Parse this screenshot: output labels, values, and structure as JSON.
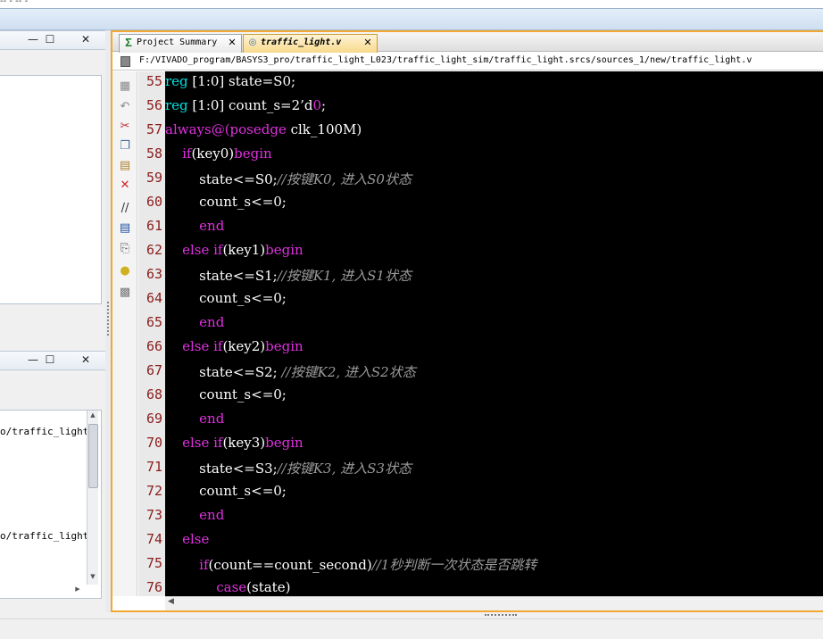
{
  "window": {
    "title_fragment": "-- - -- -"
  },
  "left_panes": [
    {
      "controls": {
        "minimize": "—",
        "maximize": "☐",
        "close": "✕"
      }
    },
    {
      "controls": {
        "minimize": "—",
        "maximize": "☐",
        "close": "✕"
      },
      "items": [
        "o/traffic_light_",
        "o/traffic_light_"
      ]
    }
  ],
  "tabs": [
    {
      "icon": "sigma-icon",
      "label": "Project Summary",
      "close": "✕",
      "active": false
    },
    {
      "icon": "verilog-file-icon",
      "label": "traffic_light.v",
      "close": "✕",
      "active": true
    }
  ],
  "file_path": "F:/VIVADO_program/BASYS3_pro/traffic_light_L023/traffic_light_sim/traffic_light.srcs/sources_1/new/traffic_light.v",
  "toolbar_icons": [
    "save-icon",
    "undo-icon",
    "cut-icon",
    "copy-icon",
    "paste-icon",
    "delete-icon",
    "comment-icon",
    "select-block-icon",
    "replace-icon",
    "hint-bulb-icon",
    "settings-icon"
  ],
  "code_lines": [
    {
      "n": "55",
      "tokens": [
        {
          "t": "reg",
          "c": "kw"
        },
        {
          "t": " [1:0] state=S0;",
          "c": ""
        }
      ]
    },
    {
      "n": "56",
      "tokens": [
        {
          "t": "reg",
          "c": "kw"
        },
        {
          "t": " [1:0] count_s=2’d",
          "c": ""
        },
        {
          "t": "0",
          "c": "mg"
        },
        {
          "t": ";",
          "c": ""
        }
      ]
    },
    {
      "n": "57",
      "tokens": [
        {
          "t": "always@(",
          "c": "mg"
        },
        {
          "t": "posedge",
          "c": "mg"
        },
        {
          "t": " clk_100M)",
          "c": ""
        }
      ]
    },
    {
      "n": "58",
      "tokens": [
        {
          "t": "    ",
          "c": ""
        },
        {
          "t": "if",
          "c": "mg"
        },
        {
          "t": "(key0)",
          "c": ""
        },
        {
          "t": "begin",
          "c": "mg"
        }
      ]
    },
    {
      "n": "59",
      "tokens": [
        {
          "t": "        state<=S0;",
          "c": ""
        },
        {
          "t": "//按键K0, 进入S0状态",
          "c": "cm"
        }
      ]
    },
    {
      "n": "60",
      "tokens": [
        {
          "t": "        count_s<=0;",
          "c": ""
        }
      ]
    },
    {
      "n": "61",
      "tokens": [
        {
          "t": "        ",
          "c": ""
        },
        {
          "t": "end",
          "c": "mg"
        }
      ]
    },
    {
      "n": "62",
      "tokens": [
        {
          "t": "    ",
          "c": ""
        },
        {
          "t": "else if",
          "c": "mg"
        },
        {
          "t": "(key1)",
          "c": ""
        },
        {
          "t": "begin",
          "c": "mg"
        }
      ]
    },
    {
      "n": "63",
      "tokens": [
        {
          "t": "        state<=S1;",
          "c": ""
        },
        {
          "t": "//按键K1, 进入S1状态",
          "c": "cm"
        }
      ]
    },
    {
      "n": "64",
      "tokens": [
        {
          "t": "        count_s<=0;",
          "c": ""
        }
      ]
    },
    {
      "n": "65",
      "tokens": [
        {
          "t": "        ",
          "c": ""
        },
        {
          "t": "end",
          "c": "mg"
        }
      ]
    },
    {
      "n": "66",
      "tokens": [
        {
          "t": "    ",
          "c": ""
        },
        {
          "t": "else if",
          "c": "mg"
        },
        {
          "t": "(key2)",
          "c": ""
        },
        {
          "t": "begin",
          "c": "mg"
        }
      ]
    },
    {
      "n": "67",
      "tokens": [
        {
          "t": "        state<=S2; ",
          "c": ""
        },
        {
          "t": "//按键K2, 进入S2状态",
          "c": "cm"
        }
      ]
    },
    {
      "n": "68",
      "tokens": [
        {
          "t": "        count_s<=0;",
          "c": ""
        }
      ]
    },
    {
      "n": "69",
      "tokens": [
        {
          "t": "        ",
          "c": ""
        },
        {
          "t": "end",
          "c": "mg"
        }
      ]
    },
    {
      "n": "70",
      "tokens": [
        {
          "t": "    ",
          "c": ""
        },
        {
          "t": "else if",
          "c": "mg"
        },
        {
          "t": "(key3)",
          "c": ""
        },
        {
          "t": "begin",
          "c": "mg"
        }
      ]
    },
    {
      "n": "71",
      "tokens": [
        {
          "t": "        state<=S3;",
          "c": ""
        },
        {
          "t": "//按键K3, 进入S3状态",
          "c": "cm"
        }
      ]
    },
    {
      "n": "72",
      "tokens": [
        {
          "t": "        count_s<=0;",
          "c": ""
        }
      ]
    },
    {
      "n": "73",
      "tokens": [
        {
          "t": "        ",
          "c": ""
        },
        {
          "t": "end",
          "c": "mg"
        }
      ]
    },
    {
      "n": "74",
      "tokens": [
        {
          "t": "    ",
          "c": ""
        },
        {
          "t": "else",
          "c": "mg"
        }
      ]
    },
    {
      "n": "75",
      "tokens": [
        {
          "t": "        ",
          "c": ""
        },
        {
          "t": "if",
          "c": "mg"
        },
        {
          "t": "(count==count_second)",
          "c": ""
        },
        {
          "t": "//1秒判断一次状态是否跳转",
          "c": "cm"
        }
      ]
    },
    {
      "n": "76",
      "tokens": [
        {
          "t": "            ",
          "c": ""
        },
        {
          "t": "case",
          "c": "mg"
        },
        {
          "t": "(state)",
          "c": ""
        }
      ]
    }
  ],
  "colors": {
    "keyword": "#00e5e5",
    "control": "#e030e0",
    "comment": "#9a9a9a",
    "code_bg": "#000000",
    "line_number": "#8b1c1c",
    "active_tab_border": "#f0a830"
  }
}
